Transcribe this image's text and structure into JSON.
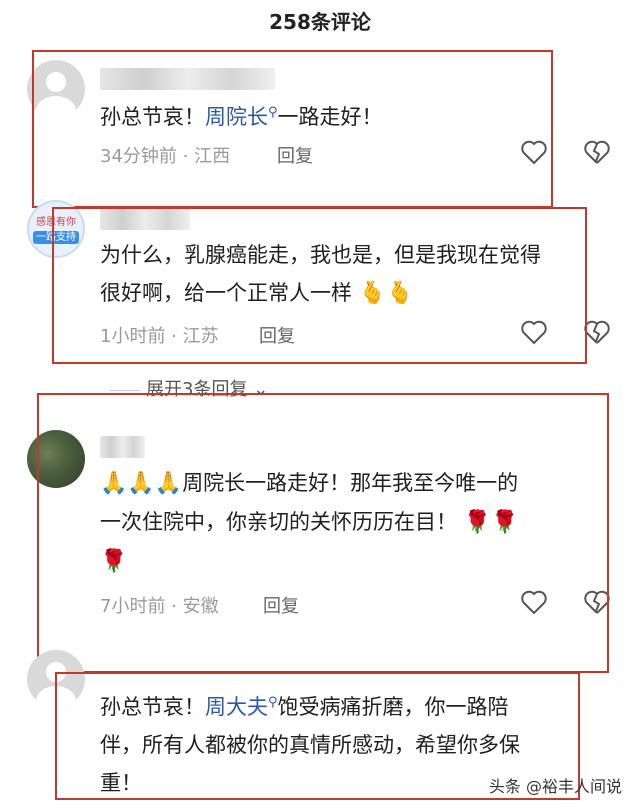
{
  "header": {
    "title": "258条评论"
  },
  "comments": [
    {
      "text_before": "孙总节哀！",
      "mention": "周院长",
      "text_after": "一路走好！",
      "time": "34分钟前",
      "location": "江西",
      "reply_label": "回复"
    },
    {
      "avatar_line1": "感恩有你",
      "avatar_line2": "一路支持",
      "line1": "为什么，乳腺癌能走，我也是，但是我现在觉得",
      "line2": "很好啊，给一个正常人一样",
      "emojis": "🫰🫰",
      "time": "1小时前",
      "location": "江苏",
      "reply_label": "回复"
    },
    {
      "line1_emoji": "🙏🙏🙏",
      "line1": "周院长一路走好！那年我至今唯一的",
      "line2": "一次住院中，你亲切的关怀历历在目！",
      "line2_emoji": "🌹🌹",
      "line3_emoji": "🌹",
      "time": "7小时前",
      "location": "安徽",
      "reply_label": "回复"
    },
    {
      "text_before": "孙总节哀！",
      "mention": "周大夫",
      "text_after": "饱受病痛折磨，你一路陪",
      "line2": "伴，所有人都被你的真情所感动，希望你多保",
      "line3": "重！"
    }
  ],
  "expand": {
    "label": "展开3条回复"
  },
  "watermark": "头条 @裕丰人间说",
  "colors": {
    "mention": "#2a5aa6",
    "annotation_box": "#c0392b"
  }
}
